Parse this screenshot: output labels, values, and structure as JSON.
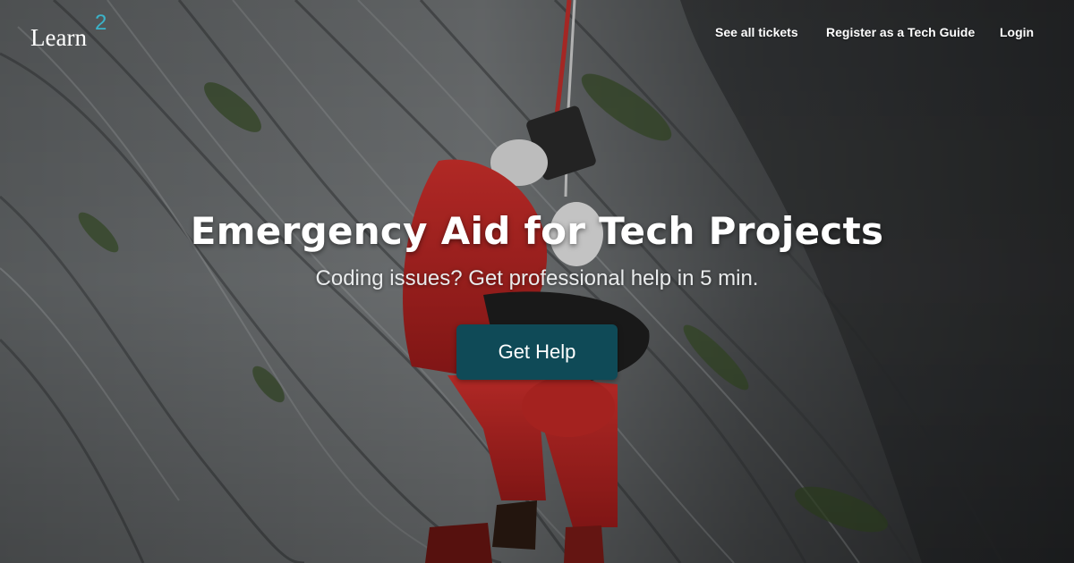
{
  "brand": {
    "name": "Learn",
    "superscript": "2"
  },
  "nav": {
    "tickets": "See all tickets",
    "register": "Register as a Tech Guide",
    "login": "Login"
  },
  "hero": {
    "headline": "Emergency Aid for Tech Projects",
    "subline": "Coding issues? Get professional help in 5 min.",
    "cta_label": "Get Help",
    "background_image": "mountain-rescue-helicopter-photo"
  },
  "colors": {
    "accent": "#3bb3c9",
    "button": "#0f4a57",
    "text": "#ffffff"
  }
}
